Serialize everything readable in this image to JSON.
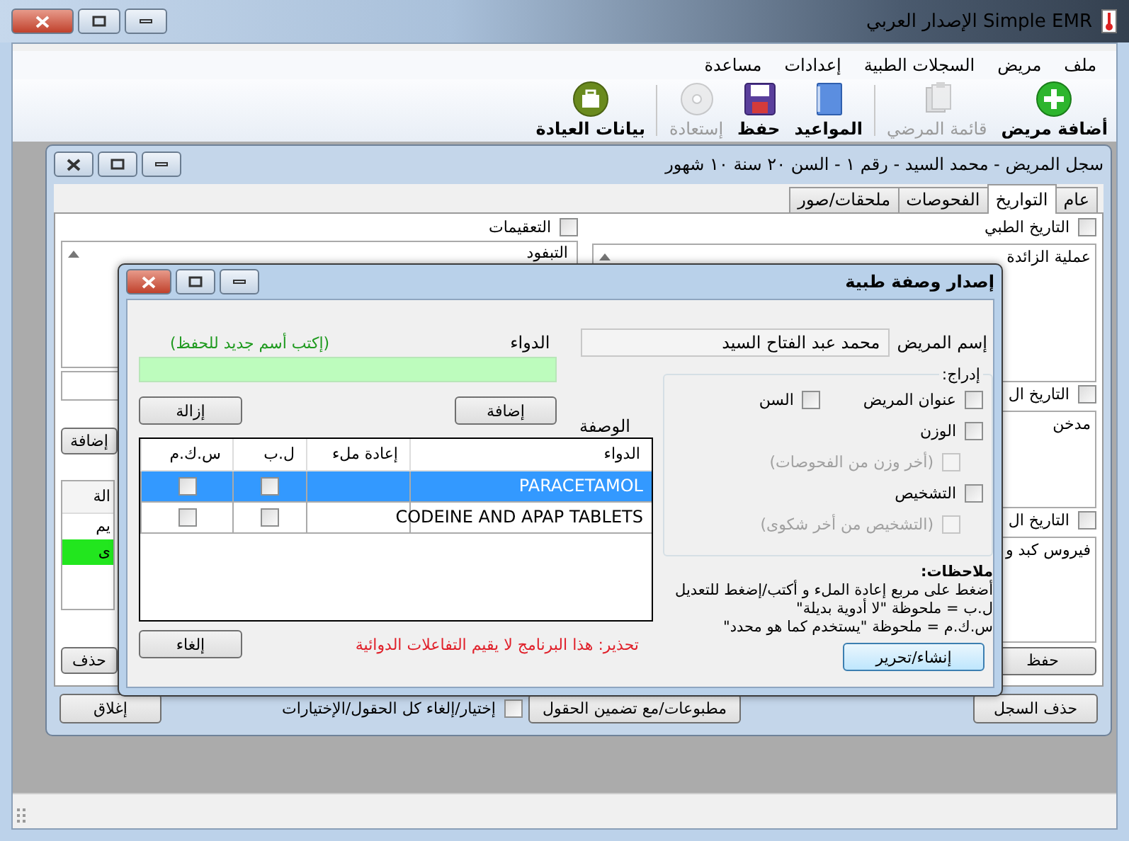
{
  "app": {
    "title": "Simple EMR الإصدار العربي"
  },
  "menu": [
    {
      "label": "ملف"
    },
    {
      "label": "مريض"
    },
    {
      "label": "السجلات الطبية"
    },
    {
      "label": "إعدادات"
    },
    {
      "label": "مساعدة"
    }
  ],
  "toolbar": [
    {
      "kind": "add",
      "label": "أضافة مريض",
      "disabled": false
    },
    {
      "kind": "list",
      "label": "قائمة المرضي",
      "disabled": true
    },
    {
      "kind": "separator"
    },
    {
      "kind": "calendar",
      "label": "المواعيد",
      "disabled": false
    },
    {
      "kind": "save",
      "label": "حفظ",
      "disabled": false
    },
    {
      "kind": "restore",
      "label": "إستعادة",
      "disabled": true
    },
    {
      "kind": "separator"
    },
    {
      "kind": "clinic",
      "label": "بيانات العيادة",
      "disabled": false
    }
  ],
  "record_window": {
    "title": "سجل المريض - محمد السيد - رقم ١ - السن ٢٠ سنة ١٠ شهور",
    "tabs": [
      {
        "label": "عام",
        "selected": false
      },
      {
        "label": "التواريخ",
        "selected": true
      },
      {
        "label": "الفحوصات",
        "selected": false
      },
      {
        "label": "ملحقات/صور",
        "selected": false
      }
    ],
    "right_sections": [
      {
        "label": "التاريخ الطبي",
        "checked": false,
        "text": "عملية الزائدة"
      },
      {
        "label": "التاريخ ال",
        "checked": false,
        "text": "مدخن"
      },
      {
        "label": "التاريخ ال",
        "checked": false,
        "text": "فيروس كبد و"
      }
    ],
    "save_button": "حفظ",
    "left_section": {
      "label": "التعقيمات",
      "checked": false,
      "text": "التبفود"
    },
    "left_add_button": "إضافة",
    "left_table": {
      "header": "الة",
      "rows": [
        {
          "text": "يم",
          "highlighted": false
        },
        {
          "text": "ى",
          "highlighted": true
        }
      ]
    },
    "left_delete_button": "حذف",
    "delete_record_button": "حذف السجل",
    "print_button": "مطبوعات/مع تضمين الحقول",
    "select_all": {
      "label": "إختيار/إلغاء كل الحقول/الإختيارات",
      "checked": false
    },
    "close_button": "إغلاق"
  },
  "prescription_dialog": {
    "title": "إصدار وصفة طبية",
    "patient_name_label": "إسم المريض",
    "patient_name": "محمد عبد الفتاح السيد",
    "drug_label": "الدواء",
    "drug_hint": "(إكتب أسم جديد للحفظ)",
    "add_button": "إضافة",
    "remove_button": "إزالة",
    "prescription_label": "الوصفة",
    "columns": [
      "الدواء",
      "إعادة ملء",
      "ل.ب",
      "س.ك.م"
    ],
    "rows": [
      {
        "drug": "PARACETAMOL",
        "selected": true,
        "no_substitutes": false,
        "as_directed": false
      },
      {
        "drug": "CODEINE AND APAP TABLETS",
        "selected": false,
        "no_substitutes": false,
        "as_directed": false
      }
    ],
    "include": {
      "title": "إدراج:",
      "rows": [
        [
          {
            "kind": "option",
            "label": "عنوان المريض",
            "checked": false,
            "disabled": false
          },
          {
            "kind": "option",
            "label": "السن",
            "checked": false,
            "disabled": false
          }
        ],
        [
          {
            "kind": "option",
            "label": "الوزن",
            "checked": false,
            "disabled": false
          }
        ],
        [
          {
            "kind": "sub",
            "label": "(أخر وزن من الفحوصات)",
            "checked": false,
            "disabled": true
          }
        ],
        [
          {
            "kind": "option",
            "label": "التشخيص",
            "checked": false,
            "disabled": false
          }
        ],
        [
          {
            "kind": "sub",
            "label": "(التشخيص من أخر شكوى)",
            "checked": false,
            "disabled": true
          }
        ]
      ]
    },
    "notes_title": "ملاحظات:",
    "notes": [
      "أضغط على مربع إعادة الملء و أكتب/إضغط للتعديل",
      "ل.ب = ملحوظة \"لا أدوية بديلة\"",
      "س.ك.م = ملحوظة \"يستخدم كما هو محدد\""
    ],
    "create_button": "إنشاء/تحرير",
    "warning": "تحذير: هذا البرنامج لا يقيم التفاعلات الدوائية",
    "cancel_button": "إلغاء"
  }
}
